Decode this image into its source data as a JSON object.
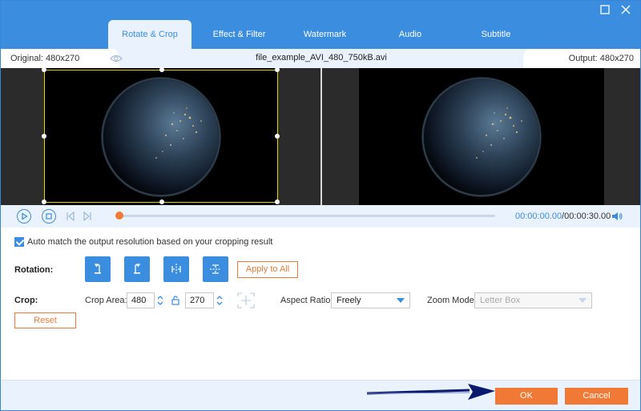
{
  "window": {
    "maximize_icon": "maximize-icon",
    "close_icon": "close-icon"
  },
  "tabs": [
    {
      "label": "Rotate & Crop",
      "active": true
    },
    {
      "label": "Effect & Filter",
      "active": false
    },
    {
      "label": "Watermark",
      "active": false
    },
    {
      "label": "Audio",
      "active": false
    },
    {
      "label": "Subtitle",
      "active": false
    }
  ],
  "info": {
    "original": "Original: 480x270",
    "filename": "file_example_AVI_480_750kB.avi",
    "output": "Output: 480x270"
  },
  "player": {
    "current_time": "00:00:00.00",
    "total_time": "/00:00:30.00",
    "progress": 0
  },
  "settings": {
    "auto_match_label": "Auto match the output resolution based on your cropping result",
    "auto_match_checked": true,
    "rotation_label": "Rotation:",
    "apply_to_all": "Apply to All",
    "crop_label": "Crop:",
    "crop_area_label": "Crop Area:",
    "crop_width": "480",
    "crop_height": "270",
    "aspect_ratio_label": "Aspect Ratio:",
    "aspect_ratio_value": "Freely",
    "zoom_mode_label": "Zoom Mode:",
    "zoom_mode_value": "Letter Box",
    "reset": "Reset"
  },
  "footer": {
    "ok": "OK",
    "cancel": "Cancel"
  },
  "colors": {
    "accent": "#3b8de0",
    "orange": "#f07a35",
    "crop_border": "#e6d200"
  }
}
